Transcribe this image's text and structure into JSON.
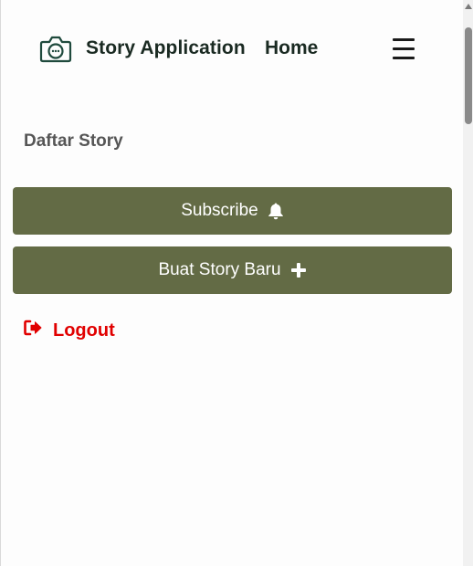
{
  "header": {
    "brand_title": "Story Application",
    "nav_home": "Home",
    "brand_color": "#1f4a3d"
  },
  "main": {
    "list_title": "Daftar Story",
    "subscribe_label": "Subscribe",
    "new_story_label": "Buat Story Baru",
    "logout_label": "Logout",
    "button_color": "#636b45",
    "logout_color": "#e10000"
  },
  "icons": {
    "brand": "camera-icon",
    "menu": "hamburger-menu-icon",
    "subscribe": "bell-icon",
    "new_story": "plus-icon",
    "logout": "sign-out-icon"
  }
}
